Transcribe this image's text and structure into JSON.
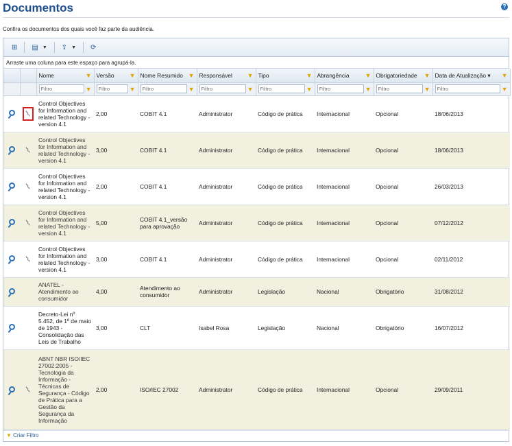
{
  "page": {
    "title": "Documentos",
    "subtitle": "Confira os documentos dos quais você faz parte da audiência.",
    "help_icon": "?"
  },
  "toolbar": {
    "buttons": [
      "hierarchy-icon",
      "columns-icon",
      "export-icon",
      "refresh-icon"
    ]
  },
  "groupbar": {
    "text": "Arraste uma coluna para este espaço para agrupá-la."
  },
  "columns": [
    "Nome",
    "Versão",
    "Nome Resumido",
    "Responsável",
    "Tipo",
    "Abrangência",
    "Obrigatoriedade",
    "Data de Atualização ▾"
  ],
  "filter_placeholder": "Filtro",
  "rows": [
    {
      "nome": "Control Objectives for Information and related Technology - version 4.1",
      "versao": "2,00",
      "resumido": "COBIT 4.1",
      "responsavel": "Administrator",
      "tipo": "Código de prática",
      "abrangencia": "Internacional",
      "obrig": "Opcional",
      "data": "18/06/2013"
    },
    {
      "nome": "Control Objectives for Information and related Technology - version 4.1",
      "versao": "3,00",
      "resumido": "COBIT 4.1",
      "responsavel": "Administrator",
      "tipo": "Código de prática",
      "abrangencia": "Internacional",
      "obrig": "Opcional",
      "data": "18/06/2013"
    },
    {
      "nome": "Control Objectives for Information and related Technology - version 4.1",
      "versao": "2,00",
      "resumido": "COBIT 4.1",
      "responsavel": "Administrator",
      "tipo": "Código de prática",
      "abrangencia": "Internacional",
      "obrig": "Opcional",
      "data": "26/03/2013"
    },
    {
      "nome": "Control Objectives for Information and related Technology - version 4.1",
      "versao": "5,00",
      "resumido": "COBIT 4.1_versão para aprovação",
      "responsavel": "Administrator",
      "tipo": "Código de prática",
      "abrangencia": "Internacional",
      "obrig": "Opcional",
      "data": "07/12/2012"
    },
    {
      "nome": "Control Objectives for Information and related Technology - version 4.1",
      "versao": "3,00",
      "resumido": "COBIT 4.1",
      "responsavel": "Administrator",
      "tipo": "Código de prática",
      "abrangencia": "Internacional",
      "obrig": "Opcional",
      "data": "02/11/2012"
    },
    {
      "nome": "ANATEL - Atendimento ao consumidor",
      "versao": "4,00",
      "resumido": "Atendimento ao consumidor",
      "responsavel": "Administrator",
      "tipo": "Legislação",
      "abrangencia": "Nacional",
      "obrig": "Obrigatório",
      "data": "31/08/2012"
    },
    {
      "nome": "Decreto-Lei nº 5.452, de 1º de maio de 1943 - Consolidação das Leis de Trabalho",
      "versao": "3,00",
      "resumido": "CLT",
      "responsavel": "Isabel Rosa",
      "tipo": "Legislação",
      "abrangencia": "Nacional",
      "obrig": "Obrigatório",
      "data": "16/07/2012"
    },
    {
      "nome": "ABNT NBR ISO/IEC 27002:2005 - Tecnologia da Informação - Técnicas de Segurança - Código de Prática para a Gestão da Segurança da Informação",
      "versao": "2,00",
      "resumido": "ISO/IEC 27002",
      "responsavel": "Administrator",
      "tipo": "Código de prática",
      "abrangencia": "Internacional",
      "obrig": "Opcional",
      "data": "29/09/2011"
    }
  ],
  "footer": {
    "create_filter": "Criar Filtro"
  }
}
